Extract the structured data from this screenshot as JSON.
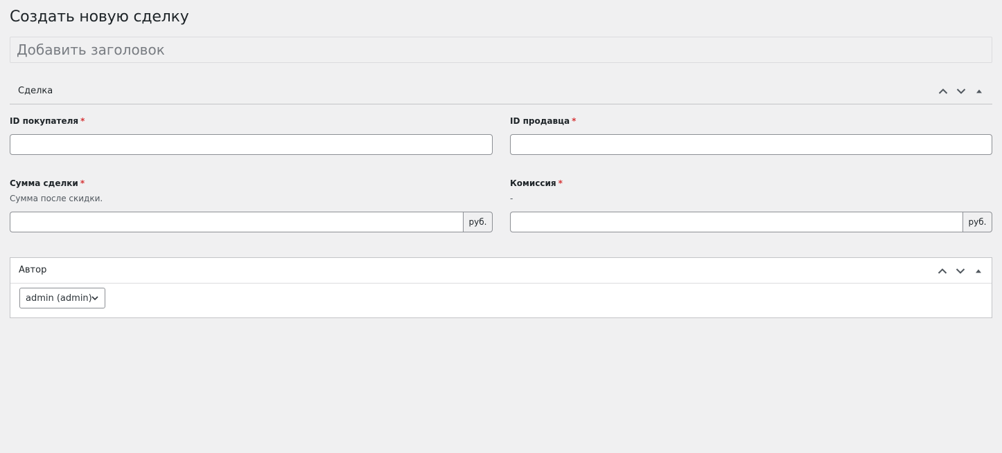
{
  "page": {
    "title": "Создать новую сделку"
  },
  "title_field": {
    "placeholder": "Добавить заголовок",
    "value": ""
  },
  "deal_section": {
    "title": "Сделка",
    "buyer_id": {
      "label": "ID покупателя",
      "required_mark": "*",
      "value": ""
    },
    "seller_id": {
      "label": "ID продавца",
      "required_mark": "*",
      "value": ""
    },
    "amount": {
      "label": "Сумма сделки",
      "required_mark": "*",
      "description": "Сумма после скидки.",
      "value": "",
      "unit": "руб."
    },
    "commission": {
      "label": "Комиссия",
      "required_mark": "*",
      "description": "-",
      "value": "",
      "unit": "руб."
    }
  },
  "author_section": {
    "title": "Автор",
    "selected": "admin (admin)"
  },
  "icons": {
    "move_up": "chevron-up-icon",
    "move_down": "chevron-down-icon",
    "toggle": "triangle-up-icon"
  },
  "colors": {
    "required": "#d63638",
    "background": "#f0f0f1",
    "border": "#8c8f94"
  }
}
